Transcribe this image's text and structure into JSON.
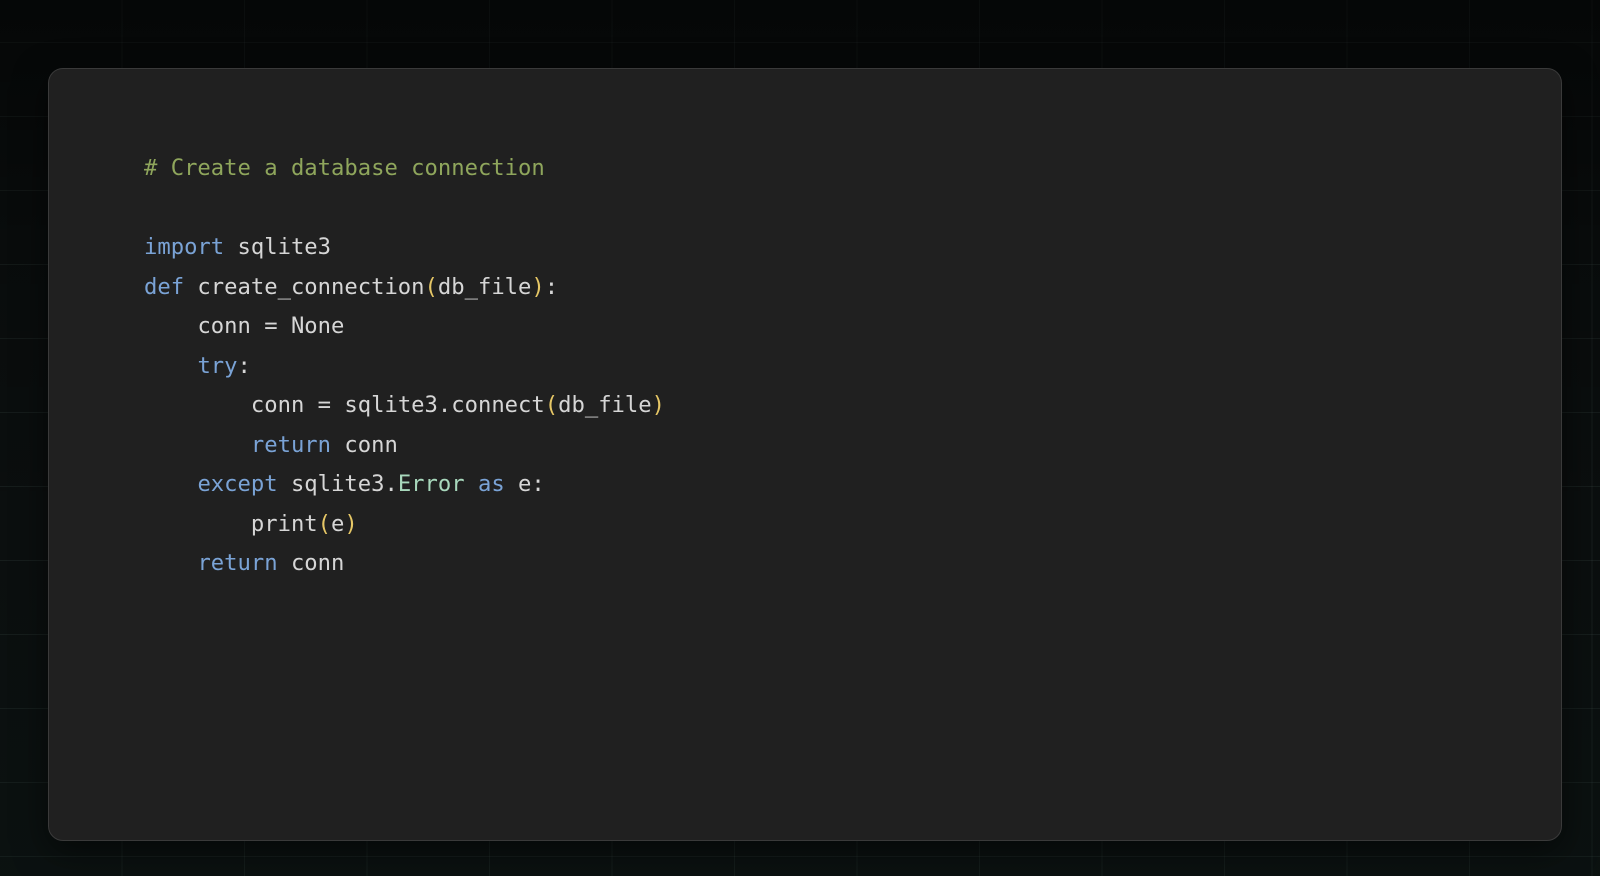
{
  "page": {
    "background_color": "#0b0f0f",
    "grid_line_color": "rgba(150,180,170,0.085)",
    "grid_cell_width": 122.5,
    "grid_cell_height": 74
  },
  "card": {
    "background_color": "#202020",
    "border_color": "#3a3a3a",
    "border_radius": 15
  },
  "editor": {
    "language": "python",
    "font_size": 22.2,
    "line_height": 39.5,
    "colors": {
      "comment": "#8fa65c",
      "keyword": "#7aa3d6",
      "plain": "#d6d6d6",
      "paren": "#e6c766",
      "class_name": "#a8d8bc"
    },
    "plain_text": "# Create a database connection\n\nimport sqlite3\ndef create_connection(db_file):\n    conn = None\n    try:\n        conn = sqlite3.connect(db_file)\n        return conn\n    except sqlite3.Error as e:\n        print(e)\n    return conn",
    "lines": [
      {
        "indent": "",
        "tokens": [
          {
            "text": "# Create a database connection",
            "type": "comment"
          }
        ]
      },
      {
        "indent": "",
        "tokens": []
      },
      {
        "indent": "",
        "tokens": [
          {
            "text": "import",
            "type": "keyword"
          },
          {
            "text": " sqlite3",
            "type": "plain"
          }
        ]
      },
      {
        "indent": "",
        "tokens": [
          {
            "text": "def",
            "type": "keyword"
          },
          {
            "text": " create_connection",
            "type": "plain"
          },
          {
            "text": "(",
            "type": "paren"
          },
          {
            "text": "db_file",
            "type": "plain"
          },
          {
            "text": ")",
            "type": "paren"
          },
          {
            "text": ":",
            "type": "punct"
          }
        ]
      },
      {
        "indent": "    ",
        "tokens": [
          {
            "text": "conn = None",
            "type": "plain"
          }
        ]
      },
      {
        "indent": "    ",
        "tokens": [
          {
            "text": "try",
            "type": "keyword"
          },
          {
            "text": ":",
            "type": "punct"
          }
        ]
      },
      {
        "indent": "        ",
        "tokens": [
          {
            "text": "conn = sqlite3.connect",
            "type": "plain"
          },
          {
            "text": "(",
            "type": "paren"
          },
          {
            "text": "db_file",
            "type": "plain"
          },
          {
            "text": ")",
            "type": "paren"
          }
        ]
      },
      {
        "indent": "        ",
        "tokens": [
          {
            "text": "return",
            "type": "keyword"
          },
          {
            "text": " conn",
            "type": "plain"
          }
        ]
      },
      {
        "indent": "    ",
        "tokens": [
          {
            "text": "except",
            "type": "keyword"
          },
          {
            "text": " sqlite3.",
            "type": "plain"
          },
          {
            "text": "Error",
            "type": "class"
          },
          {
            "text": " ",
            "type": "plain"
          },
          {
            "text": "as",
            "type": "keyword"
          },
          {
            "text": " e",
            "type": "plain"
          },
          {
            "text": ":",
            "type": "punct"
          }
        ]
      },
      {
        "indent": "        ",
        "tokens": [
          {
            "text": "print",
            "type": "plain"
          },
          {
            "text": "(",
            "type": "paren"
          },
          {
            "text": "e",
            "type": "plain"
          },
          {
            "text": ")",
            "type": "paren"
          }
        ]
      },
      {
        "indent": "    ",
        "tokens": [
          {
            "text": "return",
            "type": "keyword"
          },
          {
            "text": " conn",
            "type": "plain"
          }
        ]
      }
    ]
  }
}
